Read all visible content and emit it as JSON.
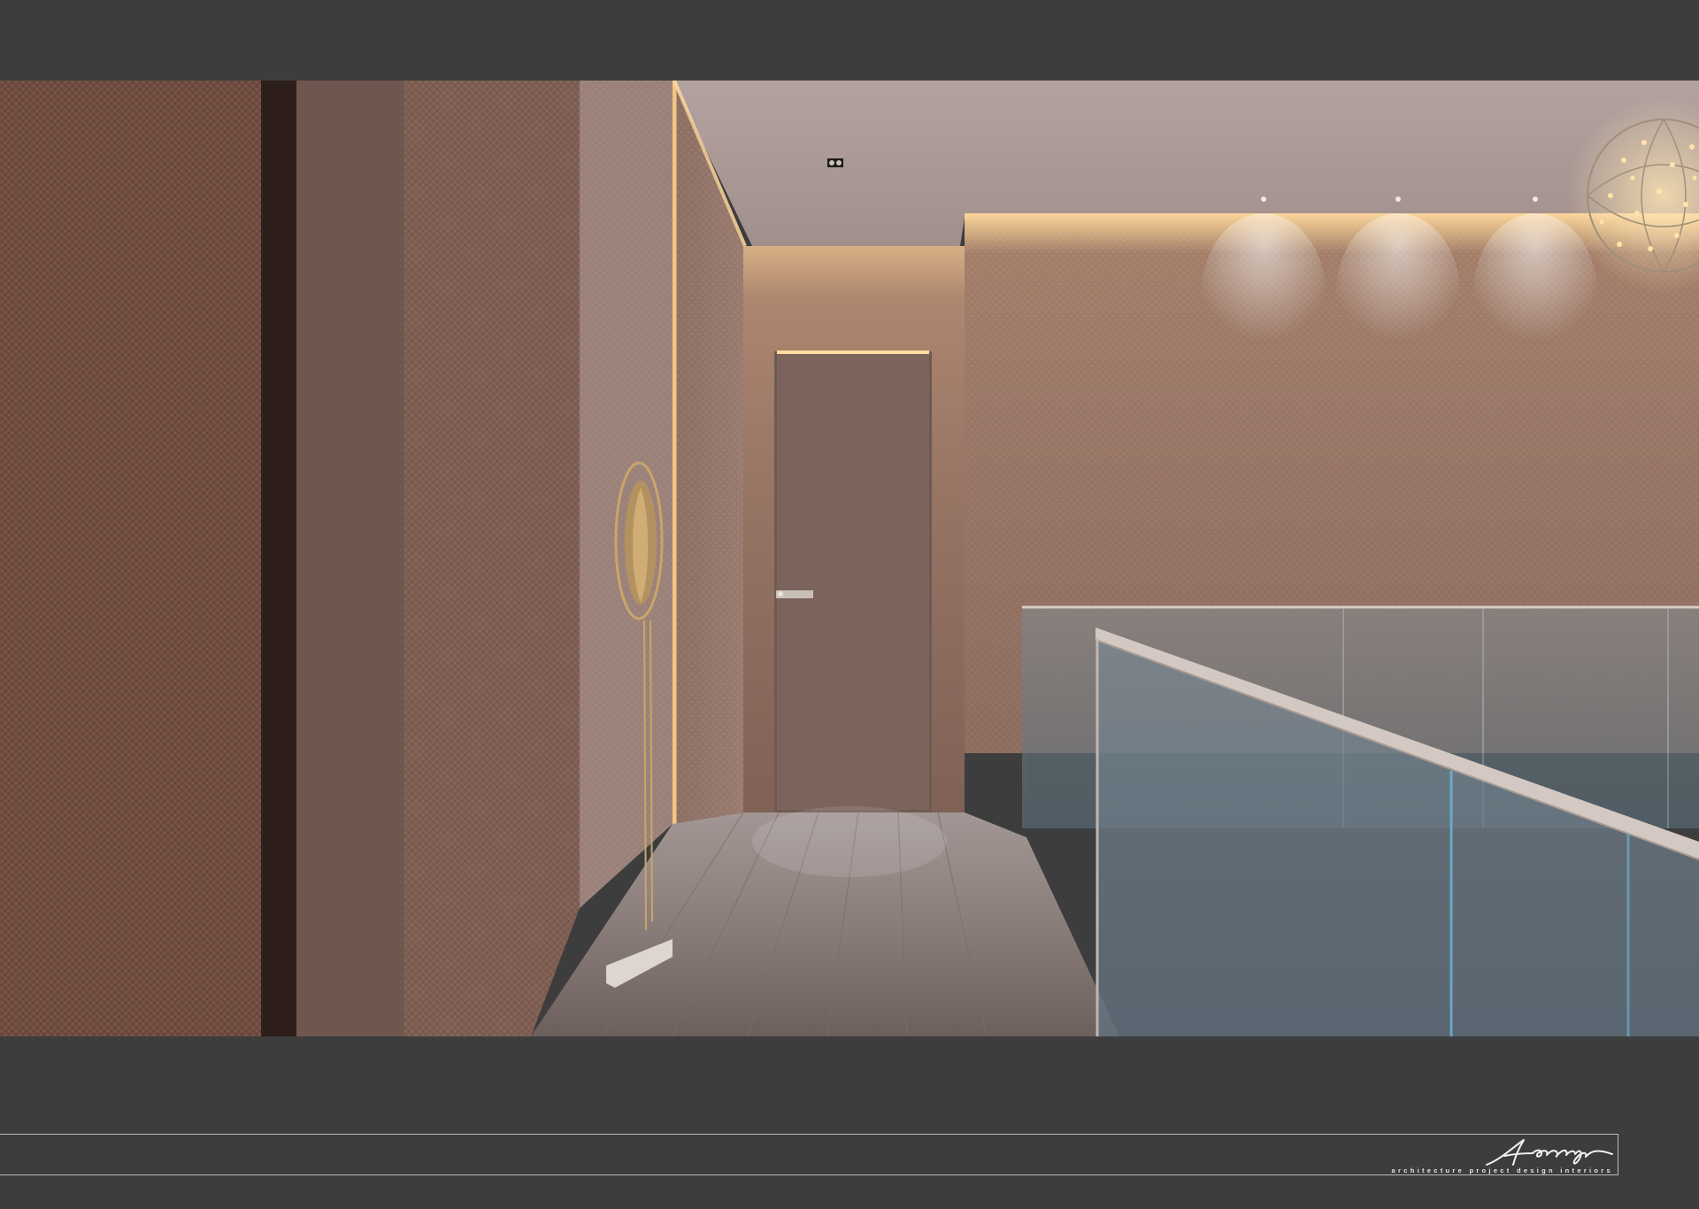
{
  "footer": {
    "logo_name": "Archigraph",
    "tagline": "architecture  project  design  interiors"
  },
  "icons": {
    "logo": "archigraph-signature-logo",
    "pendant_lamp": "sphere-pendant-lamp",
    "ceiling_light": "recessed-ceiling-light"
  },
  "colors": {
    "background": "#3d3d3d",
    "footer_line": "#b9b9b9",
    "wall_fabric": "#7a5b4e",
    "warm_light": "#e8b77a",
    "floor": "#8c7f7b"
  }
}
